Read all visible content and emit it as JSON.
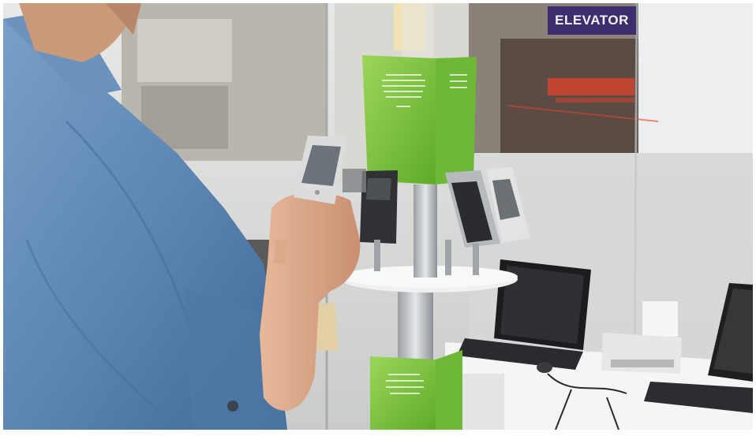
{
  "scene": {
    "description_label": "",
    "signage": {
      "elevator_sign": "ELEVATOR"
    },
    "colors": {
      "denim": "#5d86b4",
      "display_green": "#7cc43b",
      "wall_grey": "#cfd3d5",
      "sign_purple": "#3b2d6e",
      "neon_red": "#e2432a"
    },
    "objects": [
      "person-in-denim-shirt",
      "mobile-phone-in-hand",
      "phone-display-stand",
      "green-display-cards",
      "laptop-center",
      "laptop-right",
      "photo-printer",
      "white-table",
      "glass-storefront-window",
      "elevator-sign",
      "neon-sign"
    ]
  }
}
